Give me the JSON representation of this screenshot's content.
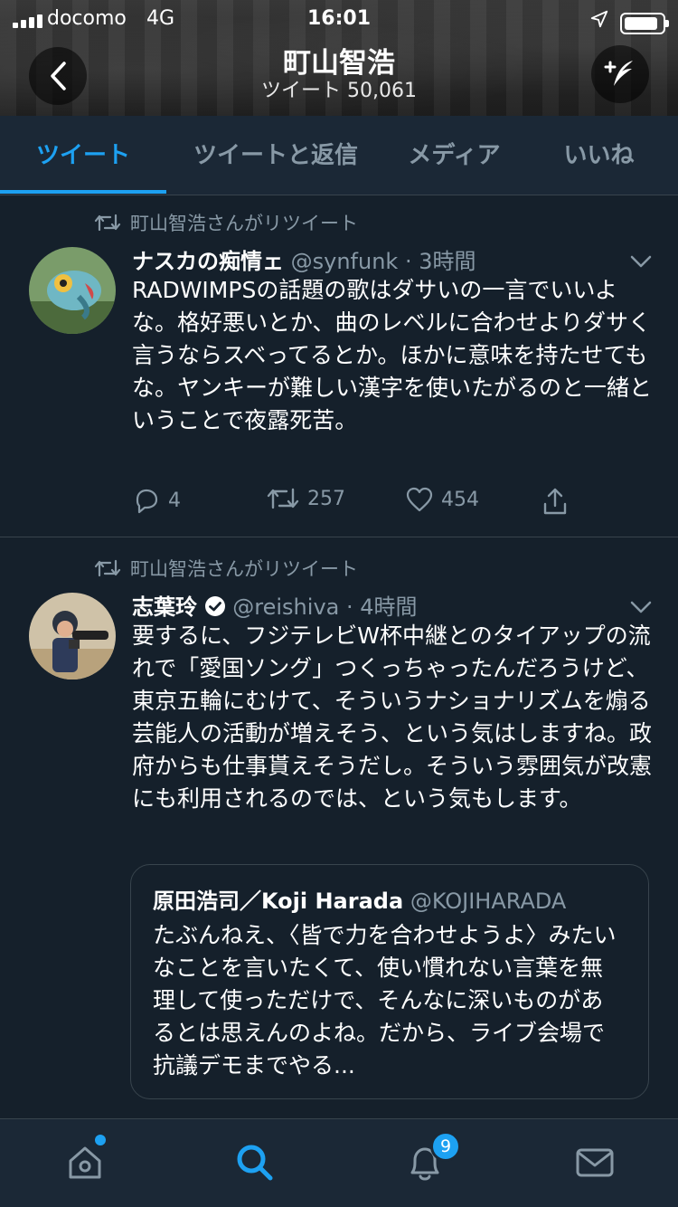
{
  "status_bar": {
    "carrier": "docomo",
    "network": "4G",
    "time": "16:01",
    "battery_level": 0.9
  },
  "header": {
    "name": "町山智浩",
    "tweet_count": "ツイート 50,061",
    "back_icon": "chevron-left-icon",
    "compose_icon": "compose-tweet-icon"
  },
  "tabs": [
    {
      "label": "ツイート",
      "active": true
    },
    {
      "label": "ツイートと返信",
      "active": false
    },
    {
      "label": "メディア",
      "active": false
    },
    {
      "label": "いいね",
      "active": false
    }
  ],
  "tweets": [
    {
      "retweet_label": "町山智浩さんがリツイート",
      "name": "ナスカの痴情ェ",
      "handle_time": "@synfunk · 3時間",
      "text": "RADWIMPSの話題の歌はダサいの一言でいいよな。格好悪いとか、曲のレベルに合わせよりダサく言うならスベってるとか。ほかに意味を持たせてもな。ヤンキーが難しい漢字を使いたがるのと一緒ということで夜露死苦。",
      "replies": "4",
      "retweets": "257",
      "likes": "454"
    },
    {
      "retweet_label": "町山智浩さんがリツイート",
      "name": "志葉玲",
      "verified": true,
      "handle_time": "@reishiva · 4時間",
      "text": "要するに、フジテレビW杯中継とのタイアップの流れで「愛国ソング」つくっちゃったんだろうけど、東京五輪にむけて、そういうナショナリズムを煽る芸能人の活動が増えそう、という気はしますね。政府からも仕事貰えそうだし。そういう雰囲気が改憲にも利用されるのでは、という気もします。",
      "quote": {
        "name": "原田浩司／Koji Harada",
        "handle": "@KOJIHARADA",
        "text": "たぶんねえ、〈皆で力を合わせようよ〉みたいなことを言いたくて、使い慣れない言葉を無理して使っただけで、そんなに深いものがあるとは思えんのよね。だから、ライブ会場で抗議デモまでやる..."
      }
    }
  ],
  "bottom_nav": {
    "home_icon": "home-icon",
    "search_icon": "search-icon",
    "notifications_icon": "bell-icon",
    "notifications_badge": "9",
    "messages_icon": "mail-icon"
  },
  "colors": {
    "background": "#15202b",
    "accent": "#1da1f2",
    "secondary_text": "#8899a6",
    "border": "#38444d"
  }
}
